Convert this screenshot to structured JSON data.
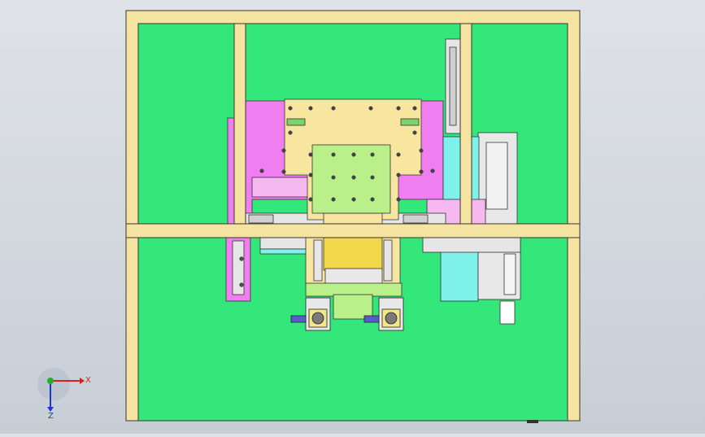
{
  "app": {
    "view": "top",
    "background_gradient": [
      "#dfe3e8",
      "#c8ced6"
    ]
  },
  "colors": {
    "frame_wood": "#f5e3a1",
    "frame_edge": "#3a3526",
    "panel_green": "#33e77a",
    "plate_magenta": "#f07ef0",
    "plate_yellow": "#f8e6a0",
    "plate_lightgreen": "#b9f08a",
    "cyan_block": "#7ef2ea",
    "grey_part": "#d9d9d9",
    "pink_block": "#f6b8f0"
  },
  "triad": {
    "x_label": "X",
    "z_label": "Z",
    "x_color": "#d62020",
    "y_color": "#22b022",
    "z_color": "#2233cc"
  }
}
